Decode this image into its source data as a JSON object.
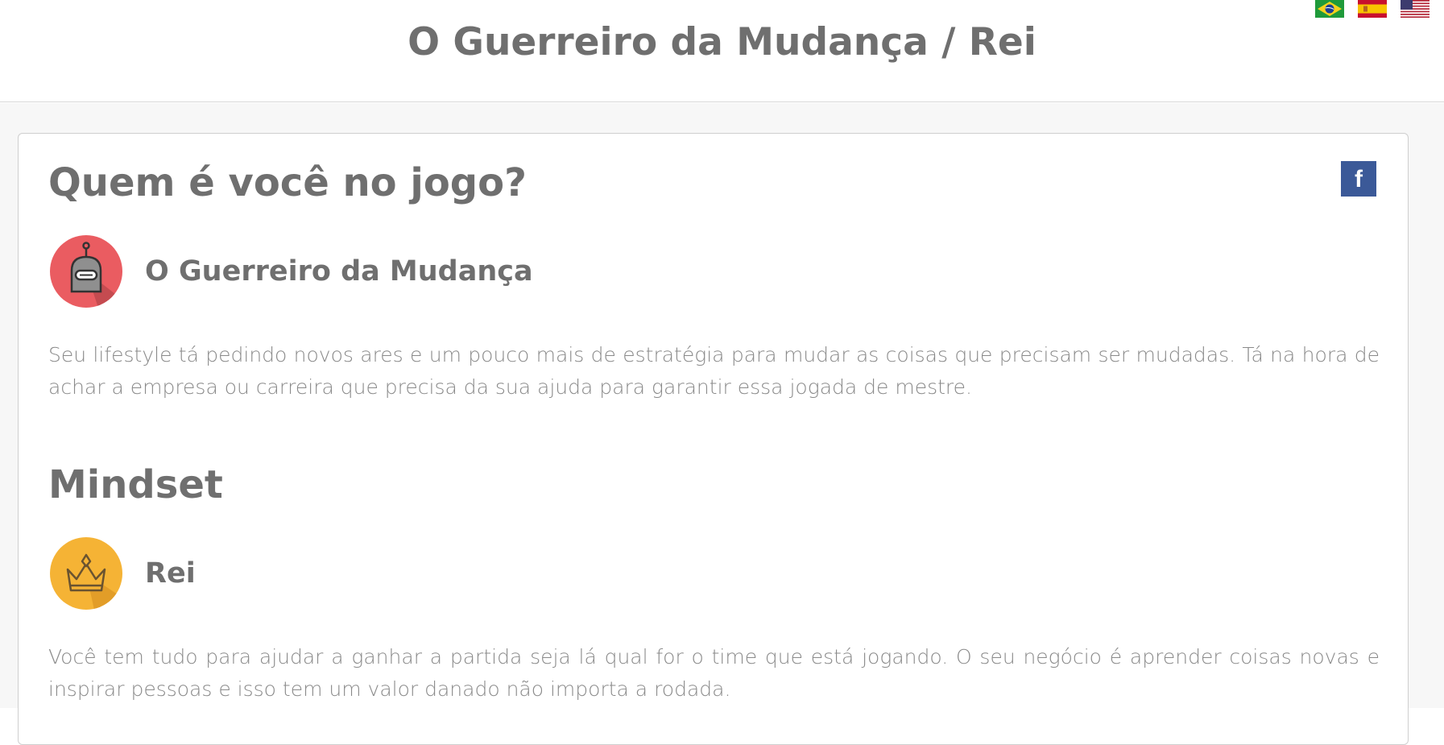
{
  "header": {
    "title": "O Guerreiro da Mudança / Rei",
    "languages": [
      {
        "name": "Português",
        "icon": "brazil-flag-icon"
      },
      {
        "name": "Español",
        "icon": "spain-flag-icon"
      },
      {
        "name": "English",
        "icon": "usa-flag-icon"
      }
    ]
  },
  "share": {
    "facebook_label": "f",
    "icon": "facebook-icon",
    "color": "#3b5998"
  },
  "player": {
    "heading": "Quem é você no jogo?",
    "name": "O Guerreiro da Mudança",
    "icon": "robot-icon",
    "icon_color": "#ea5c61",
    "description": "Seu lifestyle tá pedindo novos ares e um pouco mais de estratégia para mudar as coisas que precisam ser mudadas. Tá na hora de achar a empresa ou carreira que precisa da sua ajuda para garantir essa jogada de mestre."
  },
  "mindset": {
    "heading": "Mindset",
    "name": "Rei",
    "icon": "crown-icon",
    "icon_color": "#f5b335",
    "description": "Você tem tudo para ajudar a ganhar a partida seja lá qual for o time que está jogando. O seu negócio é aprender coisas novas e inspirar pessoas e isso tem um valor danado não importa a rodada."
  }
}
